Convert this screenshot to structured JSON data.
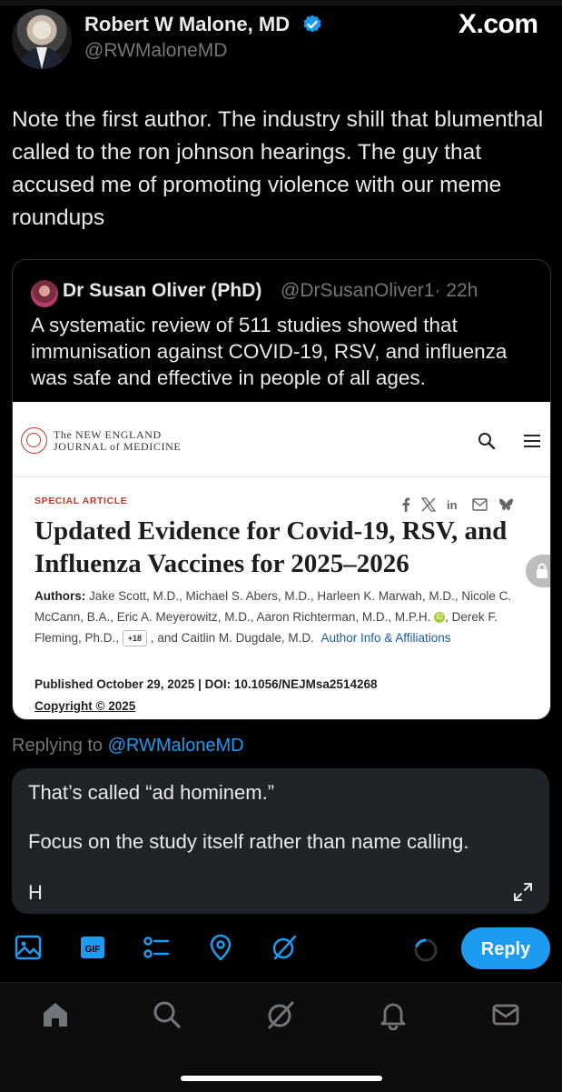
{
  "site": "X.com",
  "tweet": {
    "author_name": "Robert W Malone, MD",
    "author_handle": "@RWMaloneMD",
    "text": "Note the first author.  The industry shill that blumenthal called to the ron johnson hearings.  The guy that accused me of promoting violence with our meme roundups"
  },
  "quote": {
    "author_name": "Dr Susan Oliver (PhD)",
    "author_handle": "@DrSusanOliver1",
    "time": "· 22h",
    "text": "A systematic review of 511 studies showed that immunisation against COVID-19, RSV, and influenza was safe and effective in people of all ages.",
    "card": {
      "journal_line1": "The NEW ENGLAND",
      "journal_line2": "JOURNAL of MEDICINE",
      "section": "SPECIAL ARTICLE",
      "title": "Updated Evidence for Covid-19, RSV, and Influenza Vaccines for 2025–2026",
      "authors_label": "Authors:",
      "authors_part1": "Jake Scott, M.D., Michael S. Abers, M.D., Harleen K. Marwah, M.D., Nicole C. McCann, B.A., Eric A. Meyerowitz, M.D., Aaron Richterman, M.D., M.P.H.",
      "authors_part2": ", Derek F. Fleming, Ph.D.,",
      "more_authors": "+18",
      "authors_part3": ", and Caitlin M. Dugdale, M.D.",
      "author_info_link": "Author Info & Affiliations",
      "published": "Published October 29, 2025 | DOI: 10.1056/NEJMsa2514268",
      "copyright": "Copyright © 2025"
    }
  },
  "reply": {
    "replying_prefix": "Replying to",
    "replying_to": "@RWMaloneMD",
    "line1": "That’s called “ad hominem.”",
    "line2": "Focus on the study itself rather than name calling.",
    "line3": "H",
    "button_label": "Reply"
  },
  "colors": {
    "accent": "#1d9bf0",
    "background": "#000000",
    "composer": "#202327",
    "nejm_red": "#c0392b"
  }
}
